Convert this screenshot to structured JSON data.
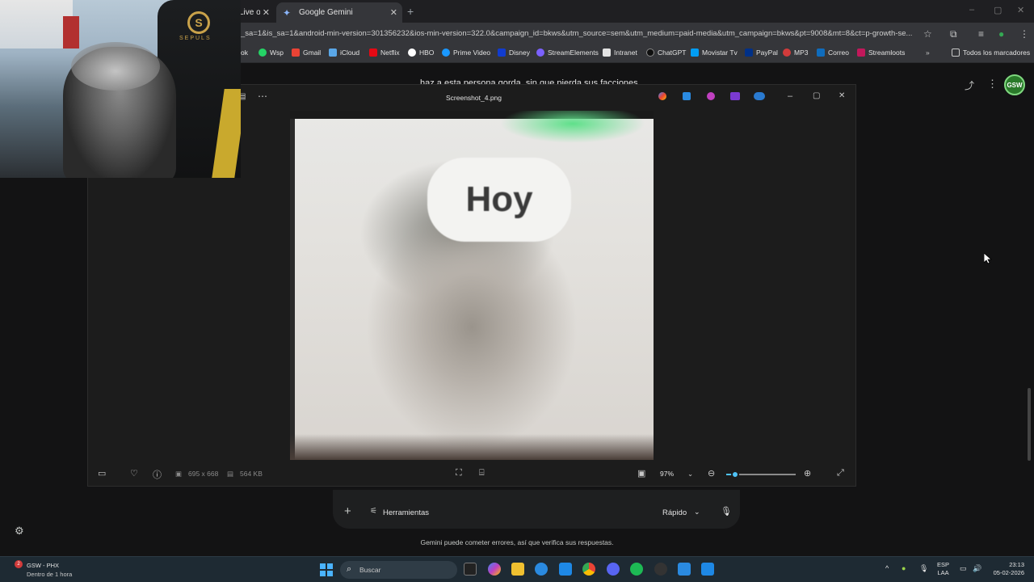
{
  "browser": {
    "tabs": [
      {
        "title": "Live o"
      },
      {
        "title": "Google Gemini"
      }
    ],
    "url": "_sa=1&is_sa=1&android-min-version=301356232&ios-min-version=322.0&campaign_id=bkws&utm_source=sem&utm_medium=paid-media&utm_campaign=bkws&pt=9008&mt=8&ct=p-growth-se...",
    "bookmarks": [
      {
        "label": "ok",
        "color": "#222"
      },
      {
        "label": "Wsp",
        "color": "#25d366"
      },
      {
        "label": "Gmail",
        "color": "#ea4335"
      },
      {
        "label": "iCloud",
        "color": "#5aa7e8"
      },
      {
        "label": "Netflix",
        "color": "#e50914"
      },
      {
        "label": "HBO",
        "color": "#ffffff"
      },
      {
        "label": "Prime Video",
        "color": "#1a98ff"
      },
      {
        "label": "Disney",
        "color": "#113ccf"
      },
      {
        "label": "StreamElements",
        "color": "#7b61ff"
      },
      {
        "label": "Intranet",
        "color": "#e3e3e3"
      },
      {
        "label": "ChatGPT",
        "color": "#0f0f0f"
      },
      {
        "label": "Movistar Tv",
        "color": "#019df4"
      },
      {
        "label": "PayPal",
        "color": "#003087"
      },
      {
        "label": "MP3",
        "color": "#d23b3b"
      },
      {
        "label": "Correo",
        "color": "#0f6cbd"
      },
      {
        "label": "Streamloots",
        "color": "#c2185b"
      }
    ],
    "all_bookmarks_label": "Todos los marcadores"
  },
  "gemini": {
    "prompt_peek": "haz a esta persona gorda, sin que pierda sus facciones",
    "avatar_text": "GSW",
    "tools_label": "Herramientas",
    "mode_label": "Rápido",
    "disclaimer": "Gemini puede cometer errores, así que verifica sus respuestas."
  },
  "viewer": {
    "file_name": "Screenshot_4.png",
    "dimensions": "695 x 668",
    "file_size": "564 KB",
    "zoom": "97%",
    "zoom_level": 0.13,
    "photo_text": "Hoy"
  },
  "webcam": {
    "brand": "SEPULS"
  },
  "taskbar": {
    "weather_title": "GSW - PHX",
    "weather_sub": "Dentro de 1 hora",
    "badge": "2",
    "search_placeholder": "Buscar",
    "lang_1": "ESP",
    "lang_2": "LAA",
    "time": "23:13",
    "date": "05-02-2026",
    "app_colors": [
      "#f0c030",
      "#2a8ae0",
      "#34a853",
      "#5865f2",
      "#1db954",
      "#333",
      "#2a8ae0",
      "#1e88e5"
    ]
  }
}
